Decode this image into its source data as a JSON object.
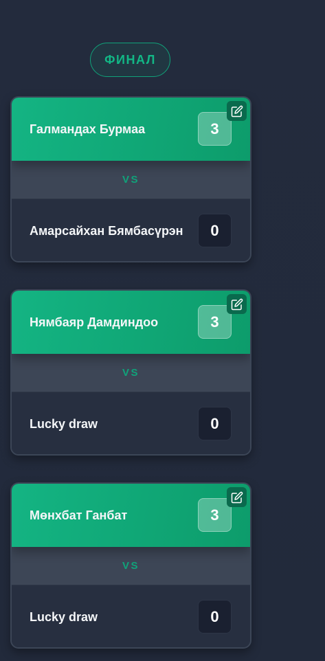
{
  "round": {
    "label": "ФИНАЛ"
  },
  "matches": [
    {
      "winner": {
        "name": "Галмандах Бурмаа",
        "score": "3"
      },
      "vs": "VS",
      "loser": {
        "name": "Амарсайхан Бямбасүрэн",
        "score": "0"
      }
    },
    {
      "winner": {
        "name": "Нямбаяр Дамдиндоо",
        "score": "3"
      },
      "vs": "VS",
      "loser": {
        "name": "Lucky draw",
        "score": "0"
      }
    },
    {
      "winner": {
        "name": "Мөнхбат Ганбат",
        "score": "3"
      },
      "vs": "VS",
      "loser": {
        "name": "Lucky draw",
        "score": "0"
      }
    }
  ],
  "colors": {
    "background": "#222a3b",
    "accent": "#10a37a",
    "winner_row": "#14b483",
    "card": "#272f40"
  },
  "icons": {
    "edit": "edit-icon"
  }
}
